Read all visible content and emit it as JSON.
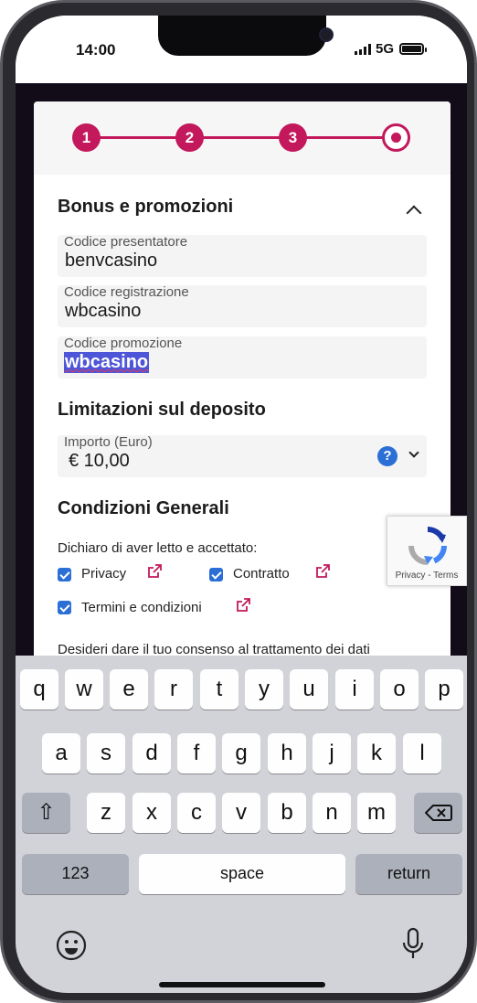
{
  "status_bar": {
    "time": "14:00",
    "network": "5G"
  },
  "stepper": {
    "steps": [
      "1",
      "2",
      "3"
    ]
  },
  "bonus": {
    "title": "Bonus e promozioni",
    "fields": [
      {
        "label": "Codice presentatore",
        "value": "benvcasino"
      },
      {
        "label": "Codice registrazione",
        "value": "wbcasino"
      },
      {
        "label": "Codice promozione",
        "value": "wbcasino"
      }
    ]
  },
  "deposit": {
    "title": "Limitazioni sul deposito",
    "amount_label": "Importo (Euro)",
    "amount_value": "€ 10,00",
    "help_symbol": "?"
  },
  "conditions": {
    "title": "Condizioni Generali",
    "declaration": "Dichiaro di aver letto e accettato:",
    "checkboxes": [
      {
        "label": "Privacy",
        "checked": true
      },
      {
        "label": "Contratto",
        "checked": true
      },
      {
        "label": "Termini e condizioni",
        "checked": true
      }
    ],
    "consent_text": "Desideri dare il tuo consenso al trattamento dei dati"
  },
  "recaptcha": {
    "links": "Privacy - Terms"
  },
  "keyboard": {
    "row1": [
      "q",
      "w",
      "e",
      "r",
      "t",
      "y",
      "u",
      "i",
      "o",
      "p"
    ],
    "row2": [
      "a",
      "s",
      "d",
      "f",
      "g",
      "h",
      "j",
      "k",
      "l"
    ],
    "row3": [
      "z",
      "x",
      "c",
      "v",
      "b",
      "n",
      "m"
    ],
    "shift": "⇧",
    "numbers": "123",
    "space": "space",
    "return": "return"
  },
  "colors": {
    "accent": "#c3185b",
    "checkbox": "#2b6fd6",
    "background": "#120c19"
  }
}
